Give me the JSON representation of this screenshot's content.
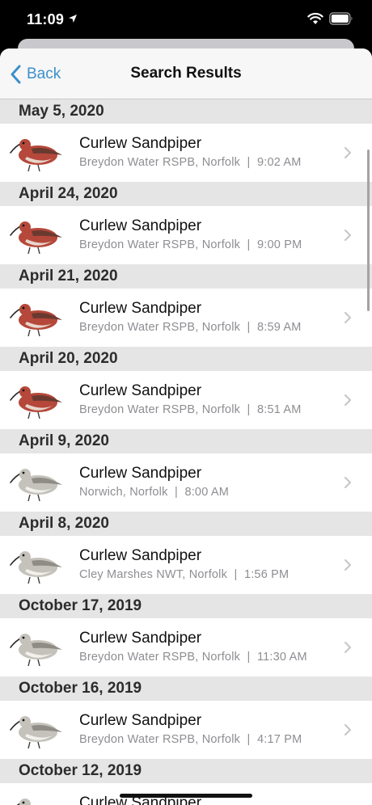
{
  "status_bar": {
    "time": "11:09"
  },
  "nav": {
    "back_label": "Back",
    "title": "Search Results"
  },
  "sections": [
    {
      "date": "May 5, 2020",
      "items": [
        {
          "name": "Curlew Sandpiper",
          "subtitle": "Breydon Water RSPB, Norfolk  |  9:02 AM",
          "plumage": "breeding"
        }
      ]
    },
    {
      "date": "April 24, 2020",
      "items": [
        {
          "name": "Curlew Sandpiper",
          "subtitle": "Breydon Water RSPB, Norfolk  |  9:00 PM",
          "plumage": "breeding"
        }
      ]
    },
    {
      "date": "April 21, 2020",
      "items": [
        {
          "name": "Curlew Sandpiper",
          "subtitle": "Breydon Water RSPB, Norfolk  |  8:59 AM",
          "plumage": "breeding"
        }
      ]
    },
    {
      "date": "April 20, 2020",
      "items": [
        {
          "name": "Curlew Sandpiper",
          "subtitle": "Breydon Water RSPB, Norfolk  |  8:51 AM",
          "plumage": "breeding"
        }
      ]
    },
    {
      "date": "April 9, 2020",
      "items": [
        {
          "name": "Curlew Sandpiper",
          "subtitle": "Norwich, Norfolk  |  8:00 AM",
          "plumage": "winter"
        }
      ]
    },
    {
      "date": "April 8, 2020",
      "items": [
        {
          "name": "Curlew Sandpiper",
          "subtitle": "Cley Marshes NWT, Norfolk  |  1:56 PM",
          "plumage": "winter"
        }
      ]
    },
    {
      "date": "October 17, 2019",
      "items": [
        {
          "name": "Curlew Sandpiper",
          "subtitle": "Breydon Water RSPB, Norfolk  |  11:30 AM",
          "plumage": "winter"
        }
      ]
    },
    {
      "date": "October 16, 2019",
      "items": [
        {
          "name": "Curlew Sandpiper",
          "subtitle": "Breydon Water RSPB, Norfolk  |  4:17 PM",
          "plumage": "winter"
        }
      ]
    },
    {
      "date": "October 12, 2019",
      "items": [
        {
          "name": "Curlew Sandpiper",
          "subtitle": "",
          "plumage": "winter"
        }
      ]
    }
  ],
  "icons": {
    "back": "chevron-left-icon",
    "disclosure": "chevron-right-icon",
    "location": "location-arrow-icon",
    "wifi": "wifi-icon",
    "battery": "battery-icon"
  },
  "colors": {
    "accent": "#3d8fcb",
    "breeding_plumage": "#b5483a",
    "winter_plumage": "#c4c2bb"
  }
}
